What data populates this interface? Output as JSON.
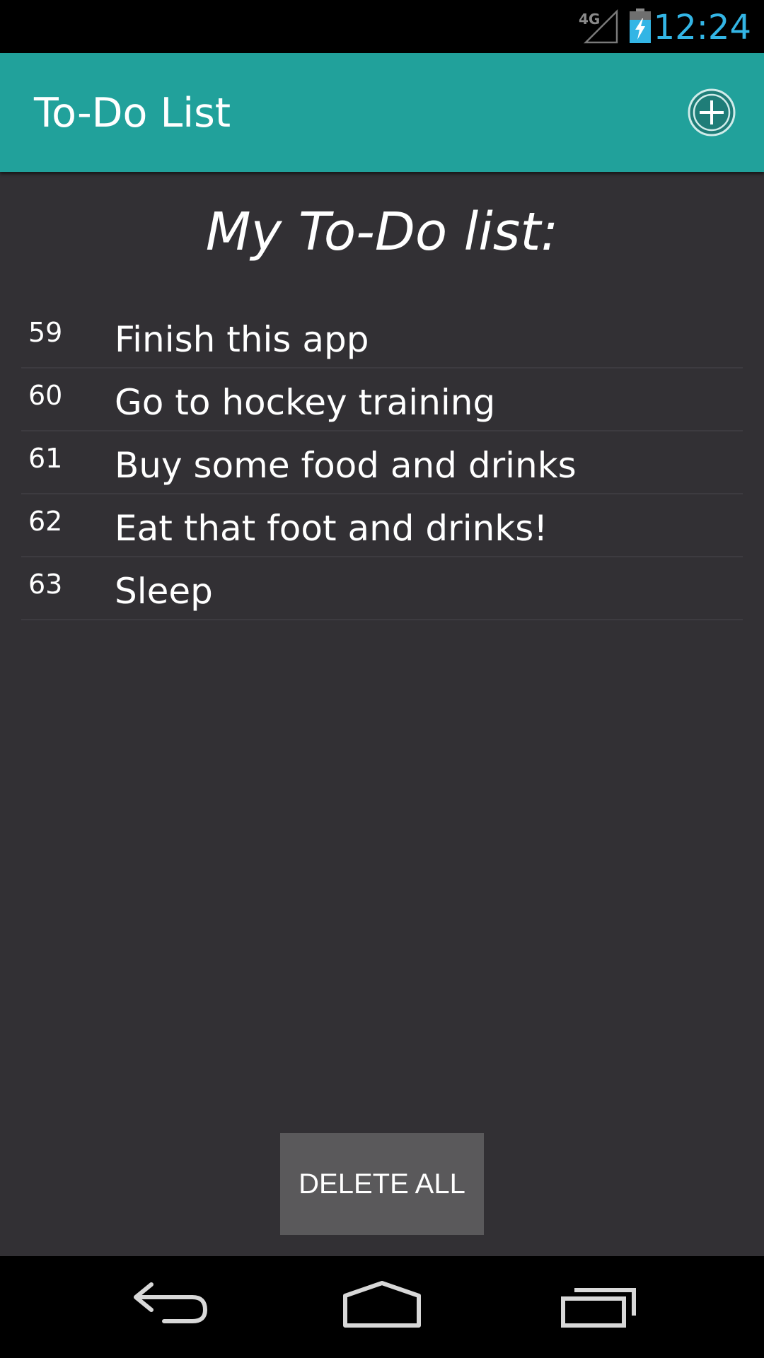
{
  "status_bar": {
    "network_label": "4G",
    "time": "12:24",
    "accent_color": "#33b5e5",
    "icons": [
      "signal-icon",
      "battery-charging-icon"
    ]
  },
  "action_bar": {
    "title": "To-Do List",
    "background_color": "#21a19b",
    "add_icon": "add-circle-icon"
  },
  "main": {
    "heading": "My To-Do list:",
    "items": [
      {
        "number": "59",
        "text": "Finish this app"
      },
      {
        "number": "60",
        "text": "Go to hockey training"
      },
      {
        "number": "61",
        "text": "Buy some food and drinks"
      },
      {
        "number": "62",
        "text": "Eat that foot and drinks!"
      },
      {
        "number": "63",
        "text": "Sleep"
      }
    ],
    "delete_all_label": "DELETE ALL"
  },
  "nav_bar": {
    "icons": [
      "back-icon",
      "home-icon",
      "recent-apps-icon"
    ]
  }
}
